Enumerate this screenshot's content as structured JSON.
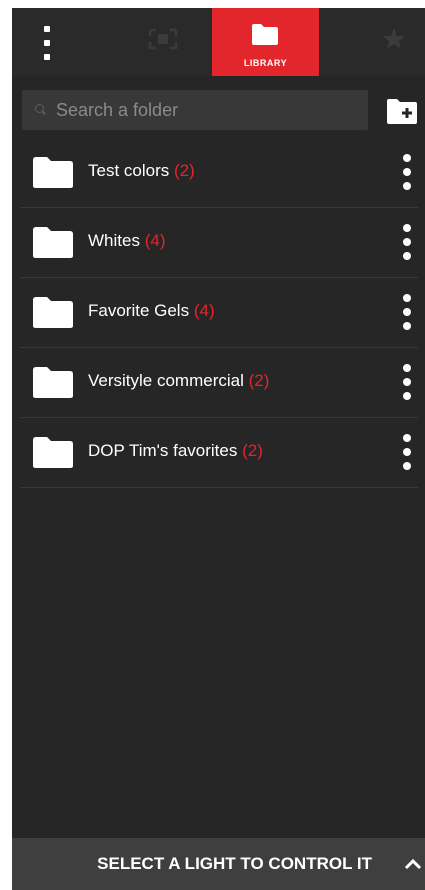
{
  "topbar": {
    "menu_icon": "more-vertical-icon",
    "tabs": [
      {
        "label": "",
        "icon": "position-icon",
        "active": false
      },
      {
        "label": "LIBRARY",
        "icon": "folder-icon",
        "active": true
      },
      {
        "label": "",
        "icon": "favorite-icon",
        "active": false
      }
    ]
  },
  "search": {
    "placeholder": "Search a folder",
    "add_icon": "folder-add-icon"
  },
  "folders": [
    {
      "name": "Test colors",
      "count": "(2)"
    },
    {
      "name": "Whites",
      "count": "(4)"
    },
    {
      "name": "Favorite Gels",
      "count": "(4)"
    },
    {
      "name": "Versityle commercial",
      "count": "(2)"
    },
    {
      "name": "DOP Tim's favorites",
      "count": " (2)"
    }
  ],
  "bottom_bar": {
    "label": "SELECT A LIGHT TO CONTROL IT",
    "icon": "chevron-up-icon"
  },
  "colors": {
    "accent": "#e2262c",
    "background": "#262626",
    "text": "#ffffff"
  }
}
